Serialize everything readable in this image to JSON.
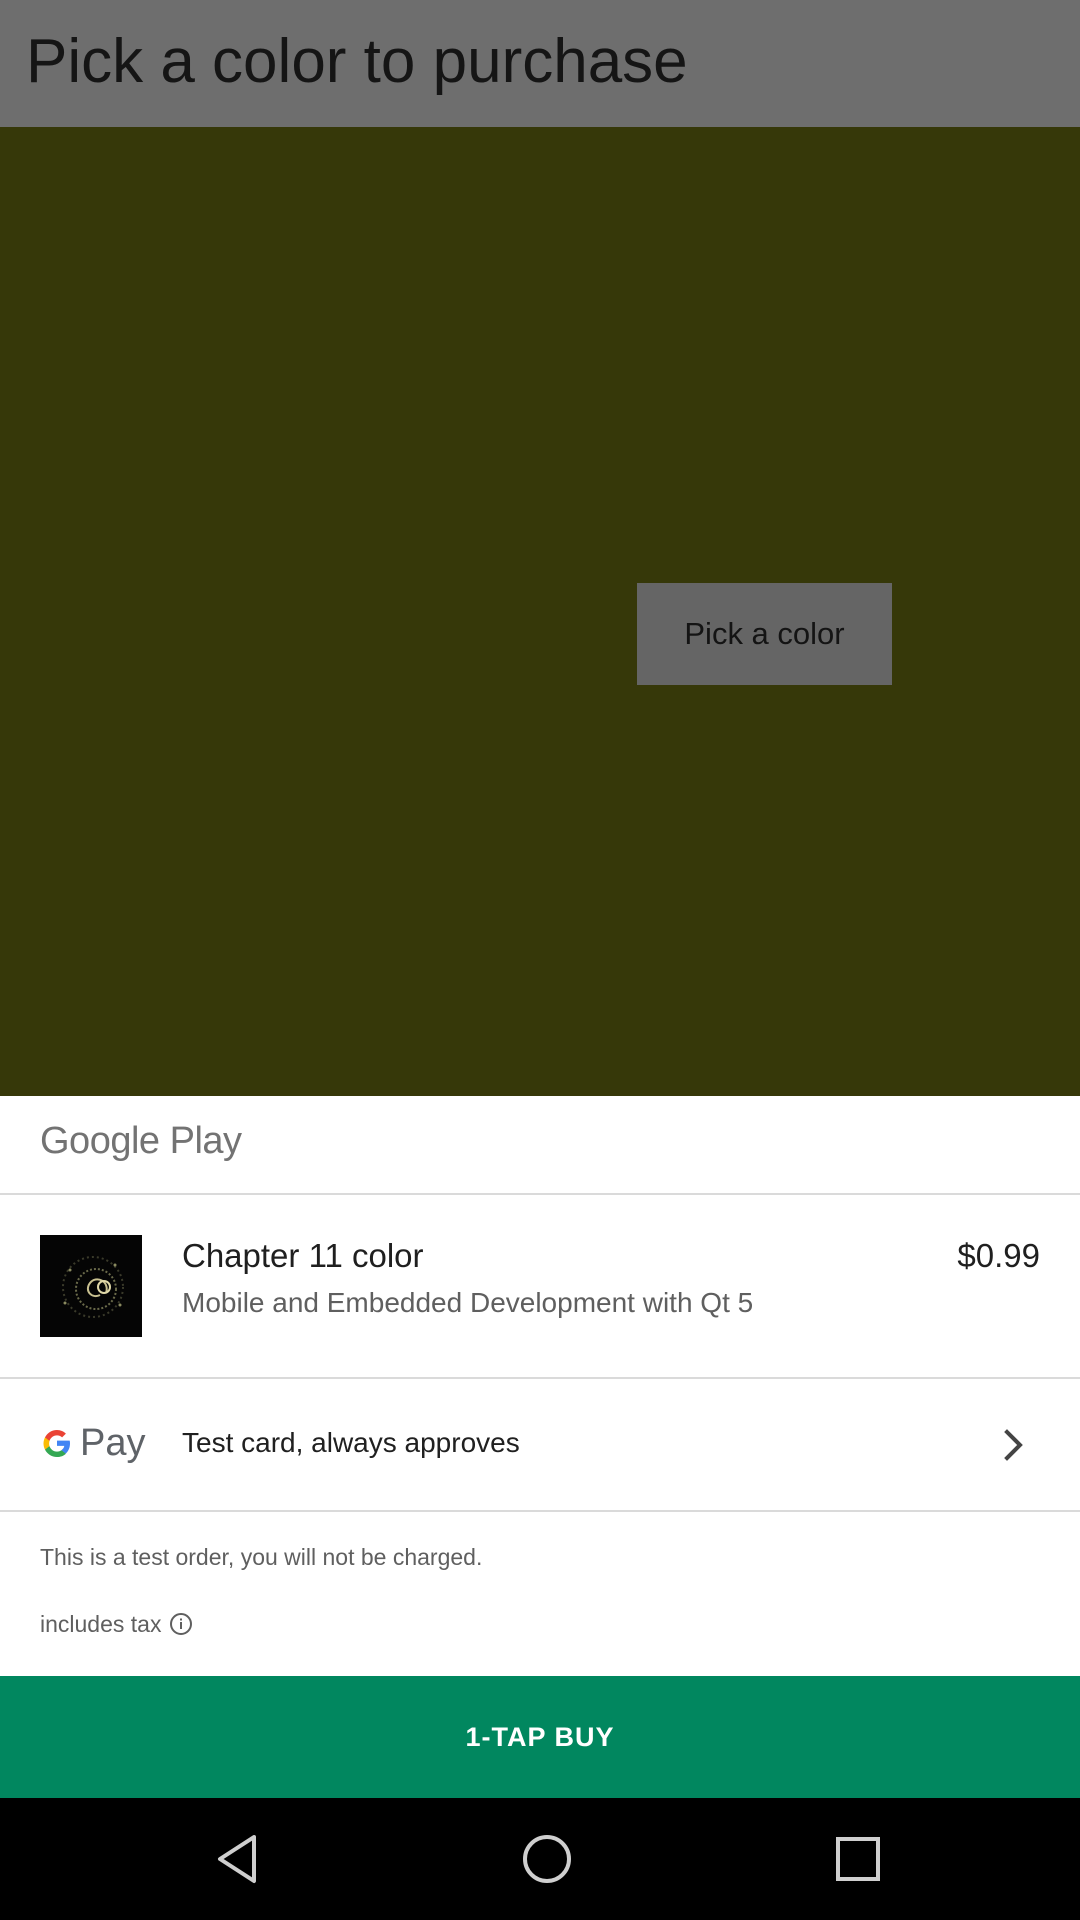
{
  "app_bar": {
    "title": "Pick a color to purchase"
  },
  "main": {
    "pick_button_label": "Pick a color",
    "background_color": "#363809"
  },
  "sheet": {
    "brand_label": "Google Play",
    "product": {
      "title": "Chapter 11 color",
      "subtitle": "Mobile and Embedded Development with Qt 5",
      "price": "$0.99",
      "thumbnail_icon": "spiral-art-icon"
    },
    "payment": {
      "provider_label": "Pay",
      "provider_icon": "google-g-icon",
      "method_label": "Test card, always approves",
      "chevron_icon": "chevron-right-icon"
    },
    "test_note": "This is a test order, you will not be charged.",
    "tax_label": "includes tax",
    "tax_info_icon": "info-icon"
  },
  "buy_button": {
    "label": "1-TAP BUY",
    "color": "#01875f"
  },
  "navigation_bar": {
    "back_icon": "back-triangle-icon",
    "home_icon": "home-circle-icon",
    "recents_icon": "recents-square-icon"
  }
}
